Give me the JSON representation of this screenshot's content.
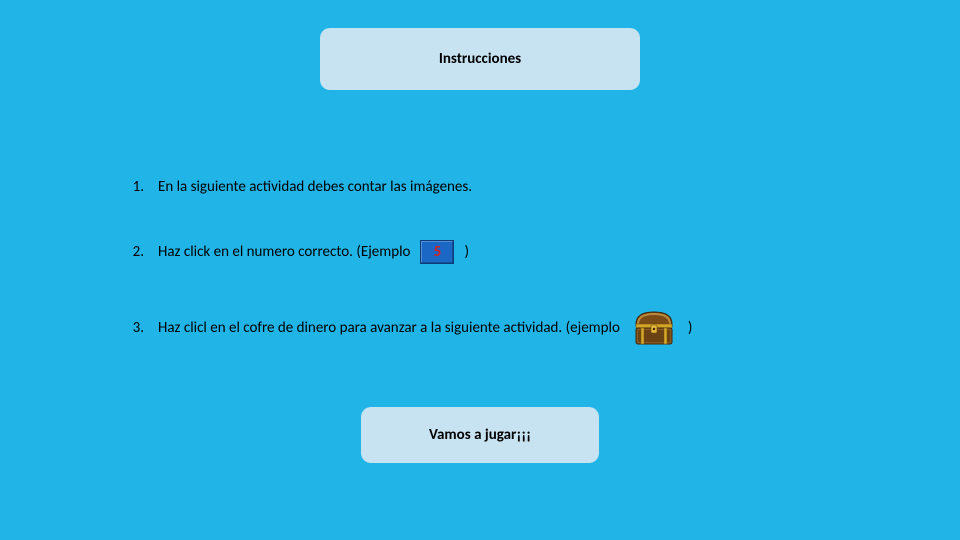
{
  "title": "Instrucciones",
  "items": [
    {
      "num": "1.",
      "text": "En la siguiente actividad debes contar las imágenes."
    },
    {
      "num": "2.",
      "text_before": "Haz click en el numero correcto.  (Ejemplo",
      "tile_value": "5",
      "text_after": ")"
    },
    {
      "num": "3.",
      "text_before": "Haz clicl en el cofre de dinero para avanzar a la siguiente actividad. (ejemplo",
      "text_after": ")"
    }
  ],
  "play_label": "Vamos a jugar¡¡¡"
}
